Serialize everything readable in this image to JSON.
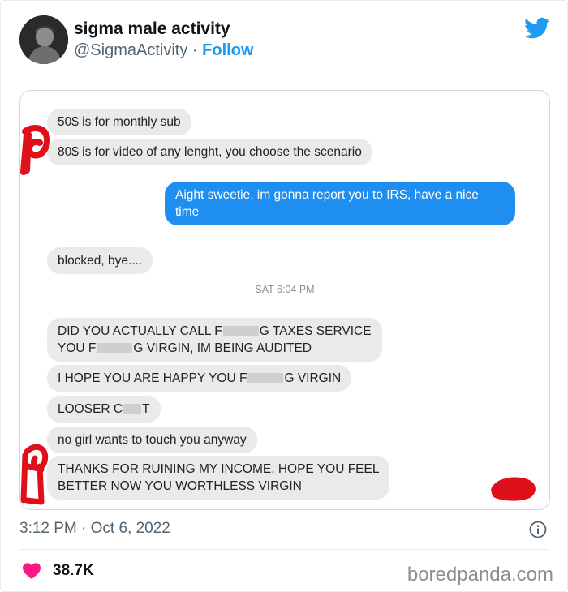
{
  "tweet": {
    "display_name": "sigma male activity",
    "handle": "@SigmaActivity",
    "separator": "·",
    "follow_label": "Follow",
    "timestamp": "3:12 PM · Oct 6, 2022",
    "likes": "38.7K",
    "icons": [
      "avatar",
      "twitter-bird-icon",
      "info-icon",
      "heart-icon"
    ],
    "colors": {
      "accent": "#1d9bf0",
      "heart": "#f91880",
      "outgoing_bubble": "#1f8ef1",
      "incoming_bubble": "#eaeaea",
      "scribble": "#e0101b"
    }
  },
  "conversation": {
    "msg1": "50$ is for monthly sub",
    "msg2": "80$ is for video of any lenght, you choose the scenario",
    "reply": "Aight sweetie, im gonna report you to IRS, have a nice time",
    "msg3": "blocked, bye....",
    "time_divider": "SAT 6:04 PM",
    "msg4_a": "DID YOU ACTUALLY CALL F",
    "msg4_b": "G TAXES SERVICE",
    "msg4_c": "YOU F",
    "msg4_d": "G VIRGIN, IM BEING AUDITED",
    "msg5_a": "I HOPE YOU ARE HAPPY YOU F",
    "msg5_b": "G VIRGIN",
    "msg6_a": "LOOSER C",
    "msg6_b": "T",
    "msg7": "no girl wants to touch you anyway",
    "msg8_a": "THANKS FOR RUINING MY INCOME, HOPE YOU FEEL",
    "msg8_b": "BETTER NOW YOU WORTHLESS VIRGIN"
  },
  "watermark": "boredpanda.com"
}
